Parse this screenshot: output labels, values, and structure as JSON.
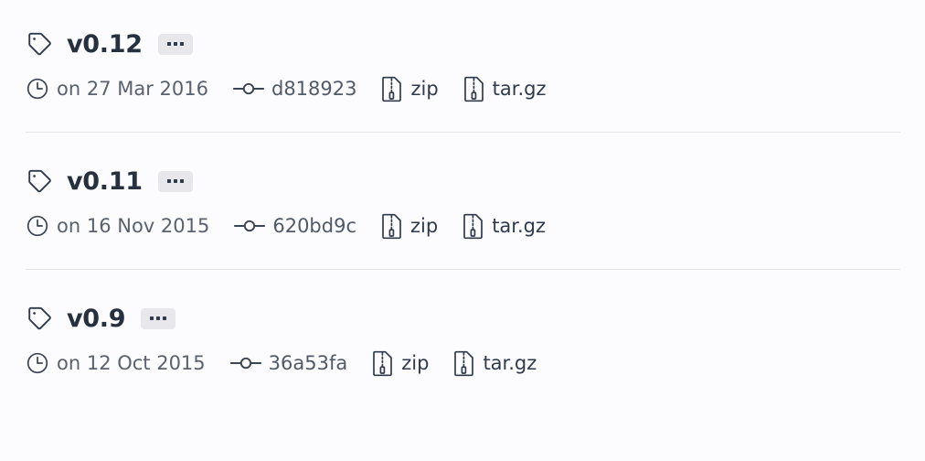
{
  "page": {
    "background_color": "#fcfbfd",
    "version_color": "#26303f",
    "meta_color": "#5a626f",
    "label_color": "#2f3b4d",
    "divider_color": "#e6e6ec",
    "button_background": "#e8e8ec"
  },
  "icons": {
    "tag": "tag-icon",
    "clock": "clock-icon",
    "commit": "commit-icon",
    "zip": "file-zip-icon",
    "ellipsis": "ellipsis-icon"
  },
  "releases": [
    {
      "version": "v0.12",
      "menu_label": "...",
      "date": "on 27 Mar 2016",
      "commit": "d818923",
      "downloads": [
        {
          "label": "zip"
        },
        {
          "label": "tar.gz"
        }
      ]
    },
    {
      "version": "v0.11",
      "menu_label": "...",
      "date": "on 16 Nov 2015",
      "commit": "620bd9c",
      "downloads": [
        {
          "label": "zip"
        },
        {
          "label": "tar.gz"
        }
      ]
    },
    {
      "version": "v0.9",
      "menu_label": "...",
      "date": "on 12 Oct 2015",
      "commit": "36a53fa",
      "downloads": [
        {
          "label": "zip"
        },
        {
          "label": "tar.gz"
        }
      ]
    }
  ]
}
